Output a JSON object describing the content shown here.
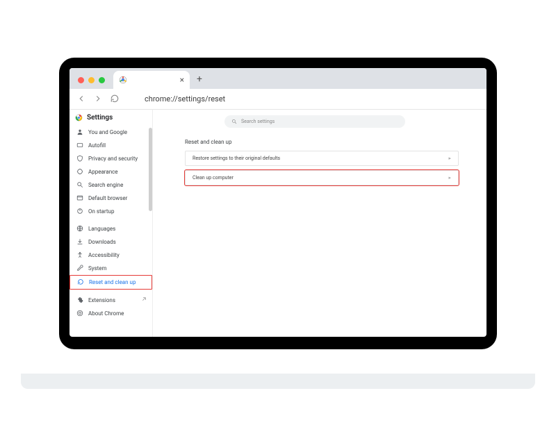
{
  "browser": {
    "url": "chrome://settings/reset",
    "tab_title": ""
  },
  "sidebar": {
    "title": "Settings",
    "items": [
      {
        "label": "You and Google",
        "icon": "person-icon"
      },
      {
        "label": "Autofill",
        "icon": "autofill-icon"
      },
      {
        "label": "Privacy and security",
        "icon": "shield-icon"
      },
      {
        "label": "Appearance",
        "icon": "appearance-icon"
      },
      {
        "label": "Search engine",
        "icon": "search-icon"
      },
      {
        "label": "Default browser",
        "icon": "browser-icon"
      },
      {
        "label": "On startup",
        "icon": "power-icon"
      }
    ],
    "items2": [
      {
        "label": "Languages",
        "icon": "globe-icon"
      },
      {
        "label": "Downloads",
        "icon": "download-icon"
      },
      {
        "label": "Accessibility",
        "icon": "accessibility-icon"
      },
      {
        "label": "System",
        "icon": "wrench-icon"
      },
      {
        "label": "Reset and clean up",
        "icon": "reset-icon",
        "active": true
      }
    ],
    "items3": [
      {
        "label": "Extensions",
        "icon": "extension-icon",
        "external": true
      },
      {
        "label": "About Chrome",
        "icon": "about-icon"
      }
    ]
  },
  "main": {
    "search_placeholder": "Search settings",
    "section_title": "Reset and clean up",
    "option1": "Restore settings to their original defaults",
    "option2": "Clean up computer"
  }
}
